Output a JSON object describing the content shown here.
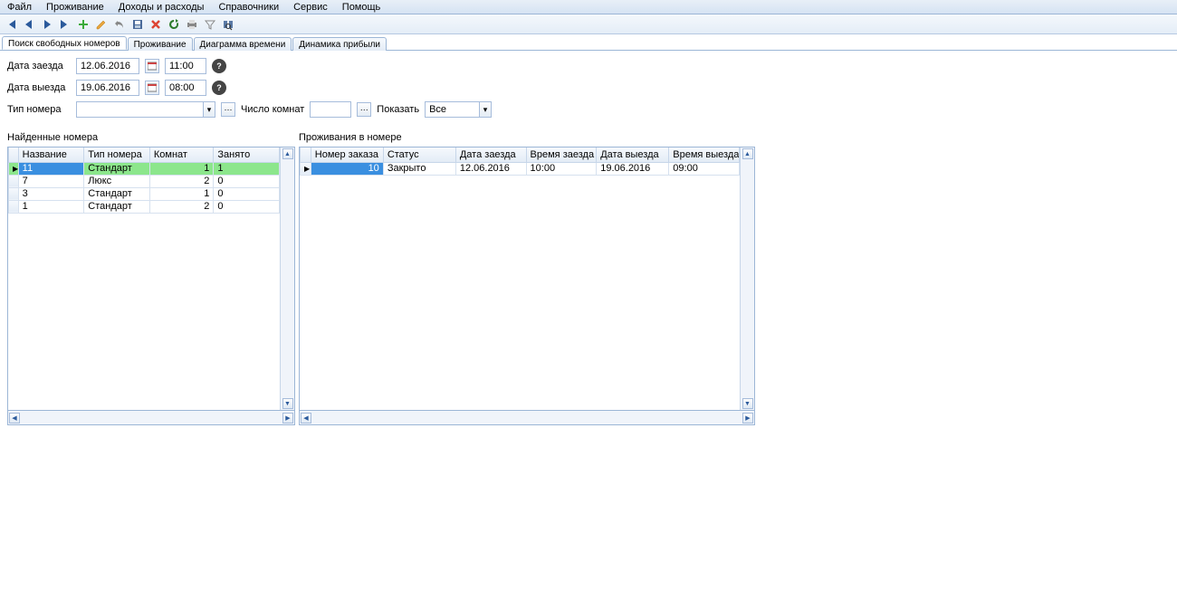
{
  "menu": [
    "Файл",
    "Проживание",
    "Доходы и расходы",
    "Справочники",
    "Сервис",
    "Помощь"
  ],
  "toolbar_icons": [
    "first",
    "prev",
    "next",
    "last",
    "add",
    "edit",
    "undo",
    "save",
    "delete",
    "refresh",
    "print",
    "filter",
    "find"
  ],
  "tabs": [
    "Поиск свободных номеров",
    "Проживание",
    "Диаграмма времени",
    "Динамика прибыли"
  ],
  "form": {
    "checkin_label": "Дата заезда",
    "checkout_label": "Дата выезда",
    "roomtype_label": "Тип номера",
    "rooms_label": "Число комнат",
    "show_label": "Показать",
    "checkin_date": "12.06.2016",
    "checkin_time": "11:00",
    "checkout_date": "19.06.2016",
    "checkout_time": "08:00",
    "roomtype_value": "",
    "rooms_value": "",
    "show_value": "Все"
  },
  "left_panel": {
    "title": "Найденные номера",
    "headers": [
      "Название",
      "Тип номера",
      "Комнат",
      "Занято"
    ],
    "rows": [
      {
        "name": "11",
        "type": "Стандарт",
        "rooms": "1",
        "busy": "1",
        "selected": true
      },
      {
        "name": "7",
        "type": "Люкс",
        "rooms": "2",
        "busy": "0"
      },
      {
        "name": "3",
        "type": "Стандарт",
        "rooms": "1",
        "busy": "0"
      },
      {
        "name": "1",
        "type": "Стандарт",
        "rooms": "2",
        "busy": "0"
      }
    ]
  },
  "right_panel": {
    "title": "Проживания в номере",
    "headers": [
      "Номер заказа",
      "Статус",
      "Дата заезда",
      "Время заезда",
      "Дата выезда",
      "Время выезда"
    ],
    "rows": [
      {
        "order": "10",
        "status": "Закрыто",
        "din": "12.06.2016",
        "tin": "10:00",
        "dout": "19.06.2016",
        "tout": "09:00",
        "selected": true
      }
    ]
  }
}
